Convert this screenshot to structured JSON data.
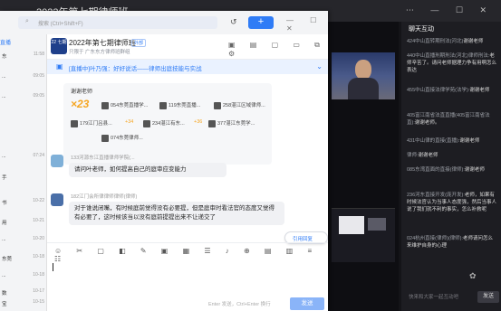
{
  "live": {
    "title": "2022年第七期律师班",
    "chat_title": "聊天互动",
    "messages": [
      {
        "user": "424中山直转期刑法(河北)",
        "text": "谢谢老师"
      },
      {
        "user": "440中山直播刑期刑法(河北)律师刑法:",
        "text": "老师辛苦了。请问老师据理力争有用啊怎么表达"
      },
      {
        "user": "455中山直接法律学苑(法学):",
        "text": "谢谢老师"
      },
      {
        "user": "405富江南省法直直播(405富江南省法直):",
        "text": "谢谢老师。"
      },
      {
        "user": "431中山律的直接(直播):",
        "text": "谢谢老师"
      },
      {
        "user": "律师:",
        "text": "谢谢老师"
      },
      {
        "user": "085东湾直面的直接(律师):",
        "text": "谢谢老师"
      },
      {
        "user": "236河东直接开发(庞开发):",
        "text": "老师，如果有时候法官认为当事人态度强，然后当事人说了我们就不利的事实，怎么补救呢"
      },
      {
        "user": "024杭州直接(律师)(律师):",
        "text": "老师请问怎么来维护自身的心理"
      }
    ],
    "input_placeholder": "快来和大家一起互动吧",
    "send_label": "发送"
  },
  "app": {
    "search_placeholder": "搜索 (Ctrl+Shift+F)",
    "add_label": "+",
    "sidebar": {
      "group_label": "直播",
      "rows": [
        {
          "name": "东",
          "time": "11:58"
        },
        {
          "name": "...",
          "time": "09:05"
        },
        {
          "name": "...",
          "time": "09:05"
        },
        {
          "name": "...",
          "time": "07:24"
        },
        {
          "name": "手",
          "time": ""
        },
        {
          "name": "书",
          "time": "10-22"
        },
        {
          "name": "用",
          "time": "10-21"
        },
        {
          "name": "...",
          "time": "10-20"
        },
        {
          "name": "东莞",
          "time": "10-18"
        },
        {
          "name": "...",
          "time": "10-18"
        },
        {
          "name": "数",
          "time": "10-17"
        },
        {
          "name": "宝",
          "time": "10-15"
        }
      ]
    },
    "conversation": {
      "avatar_text": "22 七期",
      "name": "2022年第七期律师班",
      "tag": "外部",
      "subtitle": "只限于 广东东方律师班群组",
      "banner": "[直播中]叶乃强：好好说话——律师出庭技能与实战",
      "card": {
        "to": "谢谢老师",
        "count": "×23",
        "items": [
          "054东莞直播学...",
          "119东莞直播...",
          "258湛江区域律师...",
          "179江门吕县...",
          "234湛江有东...",
          "377湛江东莞学...",
          "074东莞律师..."
        ],
        "badges": [
          "+34",
          "+36"
        ]
      },
      "messages": [
        {
          "meta": "133河源东江直播律师学院(...",
          "text": "请问叶老师，如何提高自己的庭审应变能力"
        },
        {
          "meta": "182江门会所律律师律师(律师)",
          "text": "对于谁说闭嘴，有时候庭前觉得没有必要提，但是庭审时看法官的态度又觉得有必要了，这时候该当以没有庭前提提出来不让递交了"
        }
      ],
      "reply_button": "引用回复"
    },
    "composer": {
      "hint": "Enter 发送，Ctrl+Enter 换行",
      "send_label": "发送"
    }
  }
}
